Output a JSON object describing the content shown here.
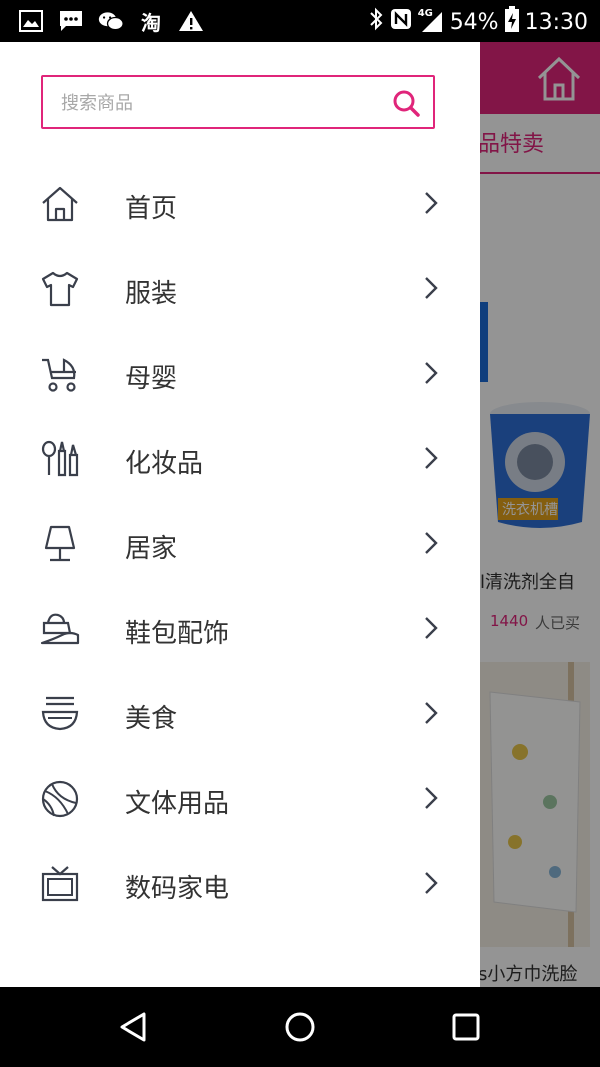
{
  "status_bar": {
    "battery": "54%",
    "time": "13:30",
    "network": "4G",
    "notification_icons": [
      "image-icon",
      "message-icon",
      "wechat-icon",
      "taobao-icon",
      "warning-icon"
    ],
    "taobao_char": "淘"
  },
  "drawer": {
    "search": {
      "placeholder": "搜索商品"
    },
    "menu": [
      {
        "label": "首页",
        "icon": "home-icon"
      },
      {
        "label": "服装",
        "icon": "tshirt-icon"
      },
      {
        "label": "母婴",
        "icon": "stroller-icon"
      },
      {
        "label": "化妆品",
        "icon": "cosmetics-icon"
      },
      {
        "label": "居家",
        "icon": "lamp-icon"
      },
      {
        "label": "鞋包配饰",
        "icon": "shoe-bag-icon"
      },
      {
        "label": "美食",
        "icon": "noodle-bowl-icon"
      },
      {
        "label": "文体用品",
        "icon": "ball-icon"
      },
      {
        "label": "数码家电",
        "icon": "tv-icon"
      }
    ]
  },
  "background_app": {
    "tab_label": "品特卖",
    "product1_title": "l清洗剂全自",
    "product1_count": "1440",
    "product1_buyers": "人已买",
    "product2_title": "s小方巾洗脸",
    "product1_label": "洗衣机槽"
  },
  "colors": {
    "accent": "#e0257a",
    "icon_stroke": "#3a3f4b"
  }
}
